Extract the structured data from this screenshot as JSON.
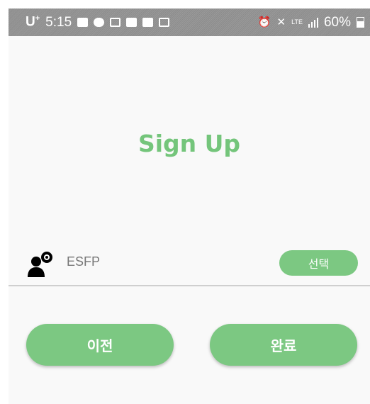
{
  "status_bar": {
    "carrier": "U",
    "carrier_sup": "+",
    "time": "5:15",
    "network": "LTE",
    "battery": "60%",
    "left_icons": [
      "message-icon",
      "chat-bubble-icon",
      "card-icon",
      "photo-icon",
      "gallery-icon",
      "wifi-call-icon"
    ],
    "right_icons": [
      "alarm-icon",
      "mute-icon",
      "lte-icon",
      "signal-icon",
      "battery-icon"
    ]
  },
  "title": "Sign Up",
  "mbti_row": {
    "icon": "user-icon",
    "value": "ESFP",
    "select_label": "선택"
  },
  "buttons": {
    "prev_label": "이전",
    "done_label": "완료"
  },
  "colors": {
    "accent": "#7cc882",
    "title": "#74c57b",
    "background": "#f9f9f9",
    "status_bar": "#939393"
  }
}
